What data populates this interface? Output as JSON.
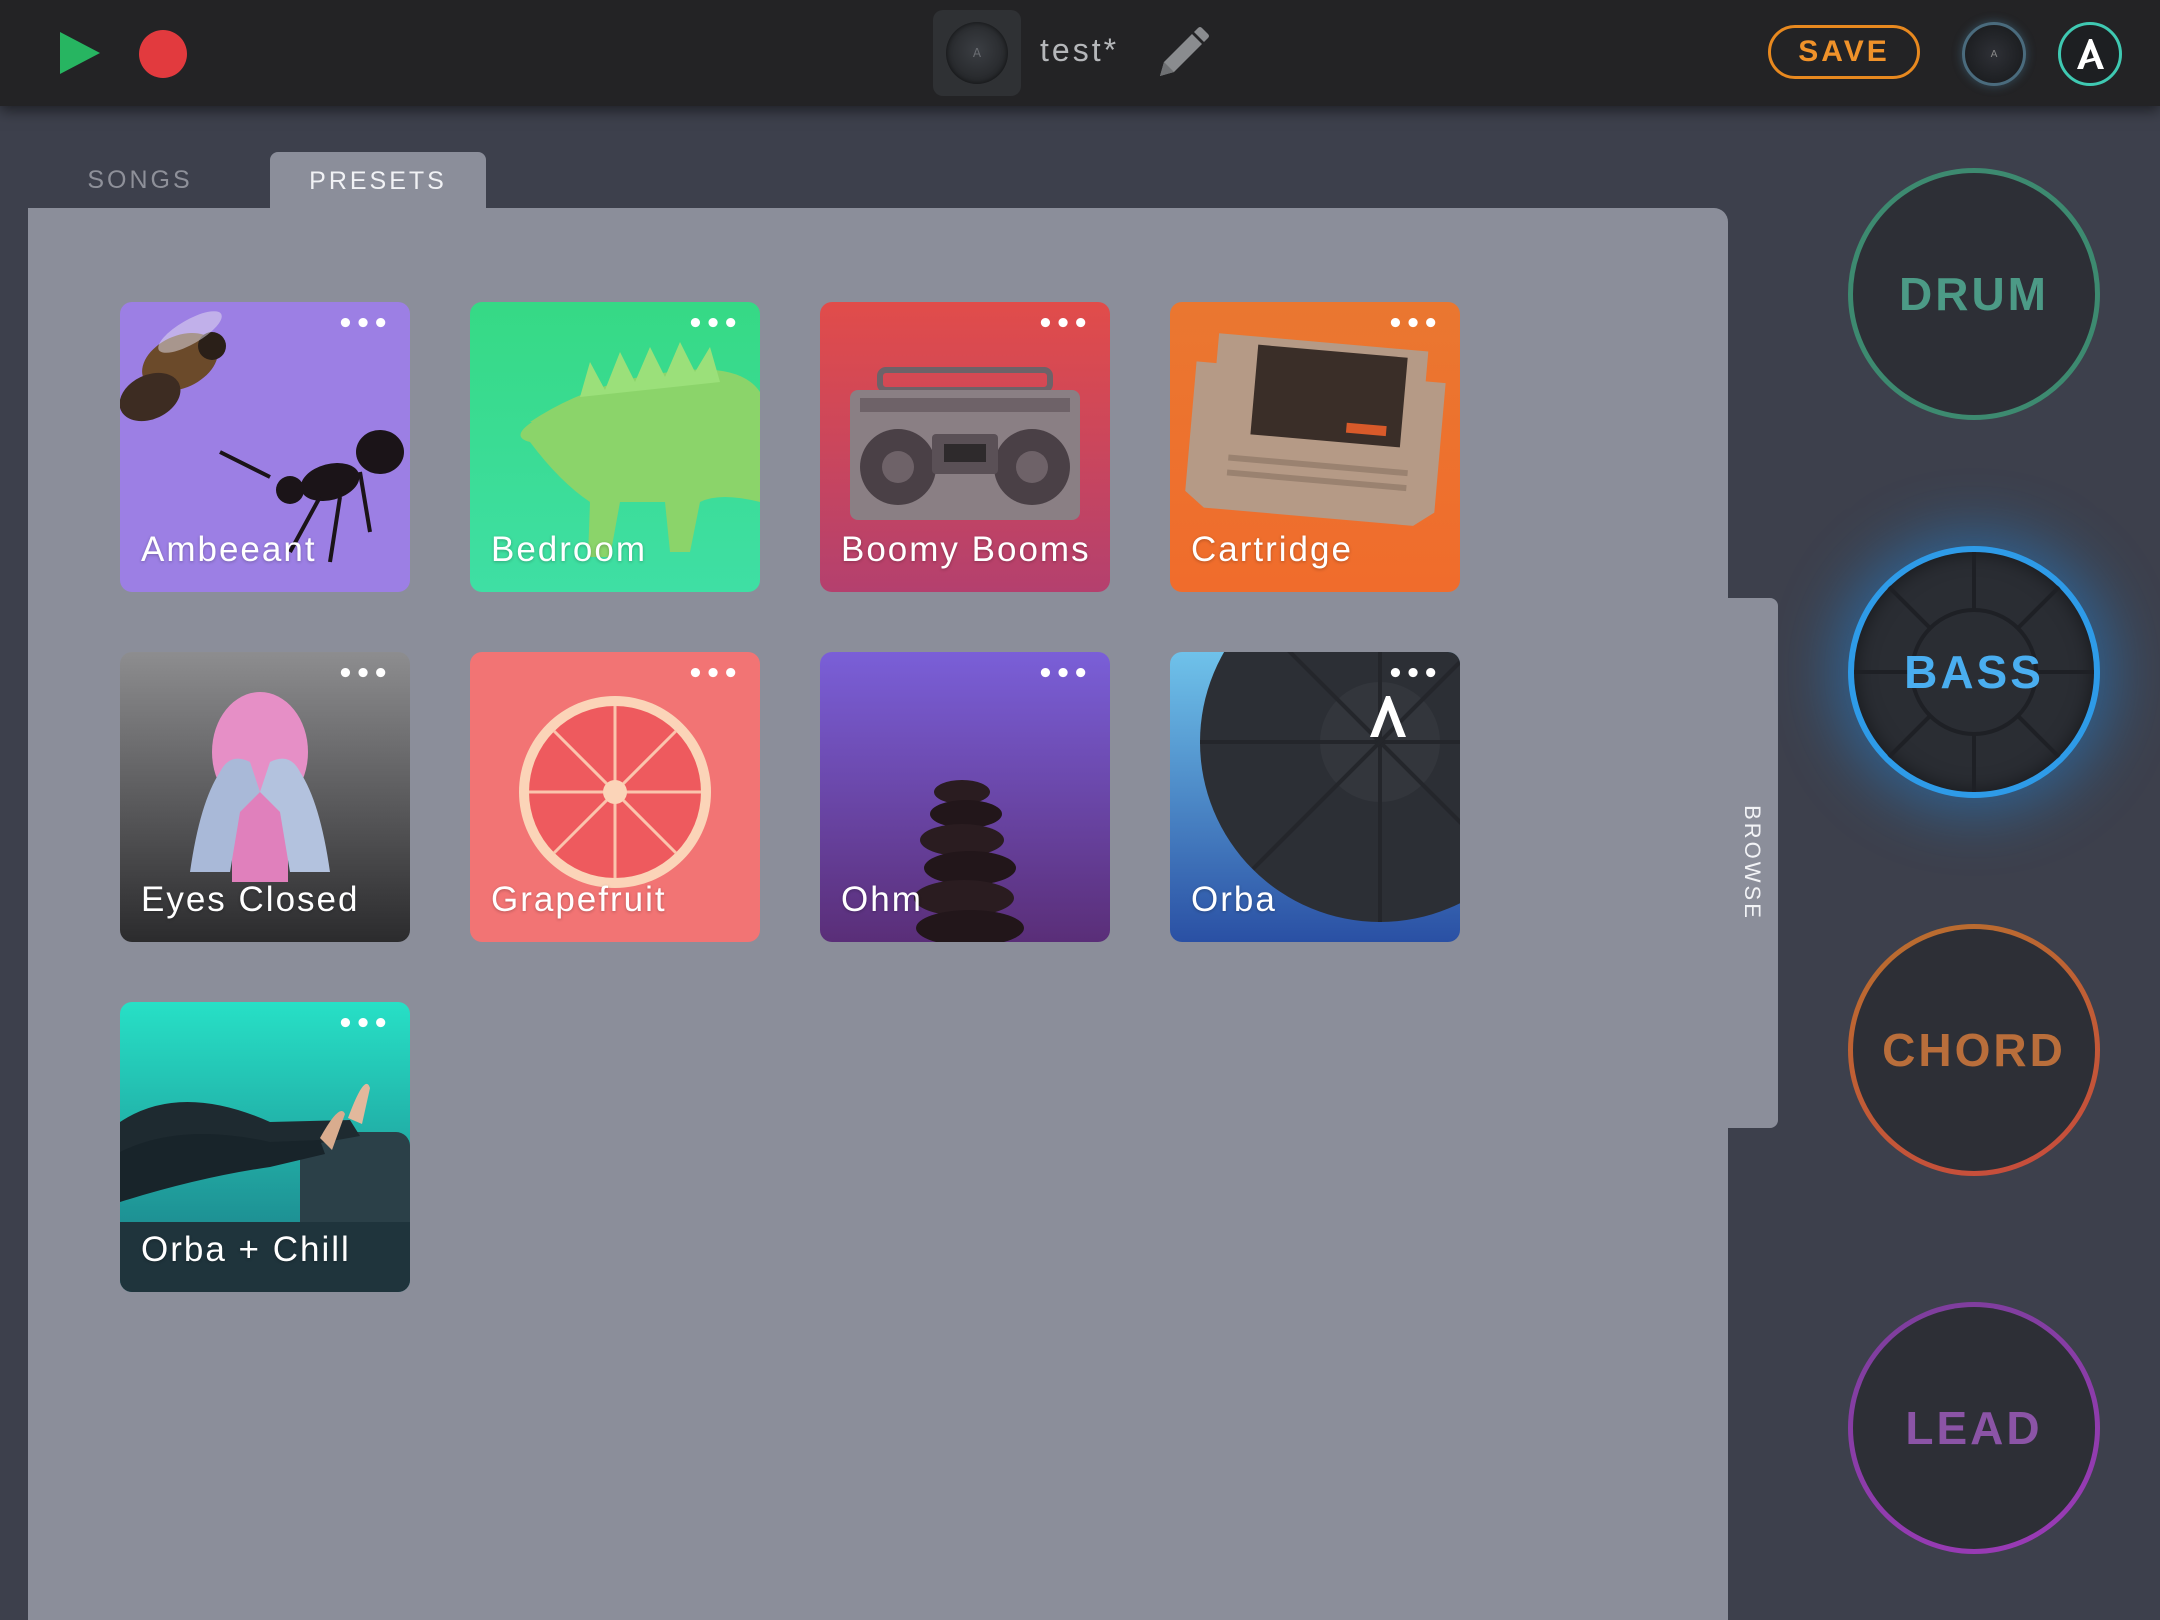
{
  "topbar": {
    "song_title": "test*",
    "save_label": "SAVE",
    "play_icon": "play-icon",
    "record_icon": "record-icon",
    "edit_icon": "pencil-icon",
    "accent_color": "#e8891f"
  },
  "tabs": [
    {
      "label": "SONGS",
      "selected": false
    },
    {
      "label": "PRESETS",
      "selected": true
    }
  ],
  "browse_label": "BROWSE",
  "presets": [
    {
      "name": "Ambeeant",
      "menu": "•••"
    },
    {
      "name": "Bedroom",
      "menu": "•••"
    },
    {
      "name": "Boomy Booms",
      "menu": "•••"
    },
    {
      "name": "Cartridge",
      "menu": "•••"
    },
    {
      "name": "Eyes Closed",
      "menu": "•••"
    },
    {
      "name": "Grapefruit",
      "menu": "•••"
    },
    {
      "name": "Ohm",
      "menu": "•••"
    },
    {
      "name": "Orba",
      "menu": "•••"
    },
    {
      "name": "Orba + Chill",
      "menu": "•••"
    }
  ],
  "instruments": [
    {
      "label": "DRUM",
      "active": false,
      "color": "#3d8a70"
    },
    {
      "label": "BASS",
      "active": true,
      "color": "#2e9be8"
    },
    {
      "label": "CHORD",
      "active": false,
      "color": "#b8702e"
    },
    {
      "label": "LEAD",
      "active": false,
      "color": "#8b3fa8"
    }
  ]
}
